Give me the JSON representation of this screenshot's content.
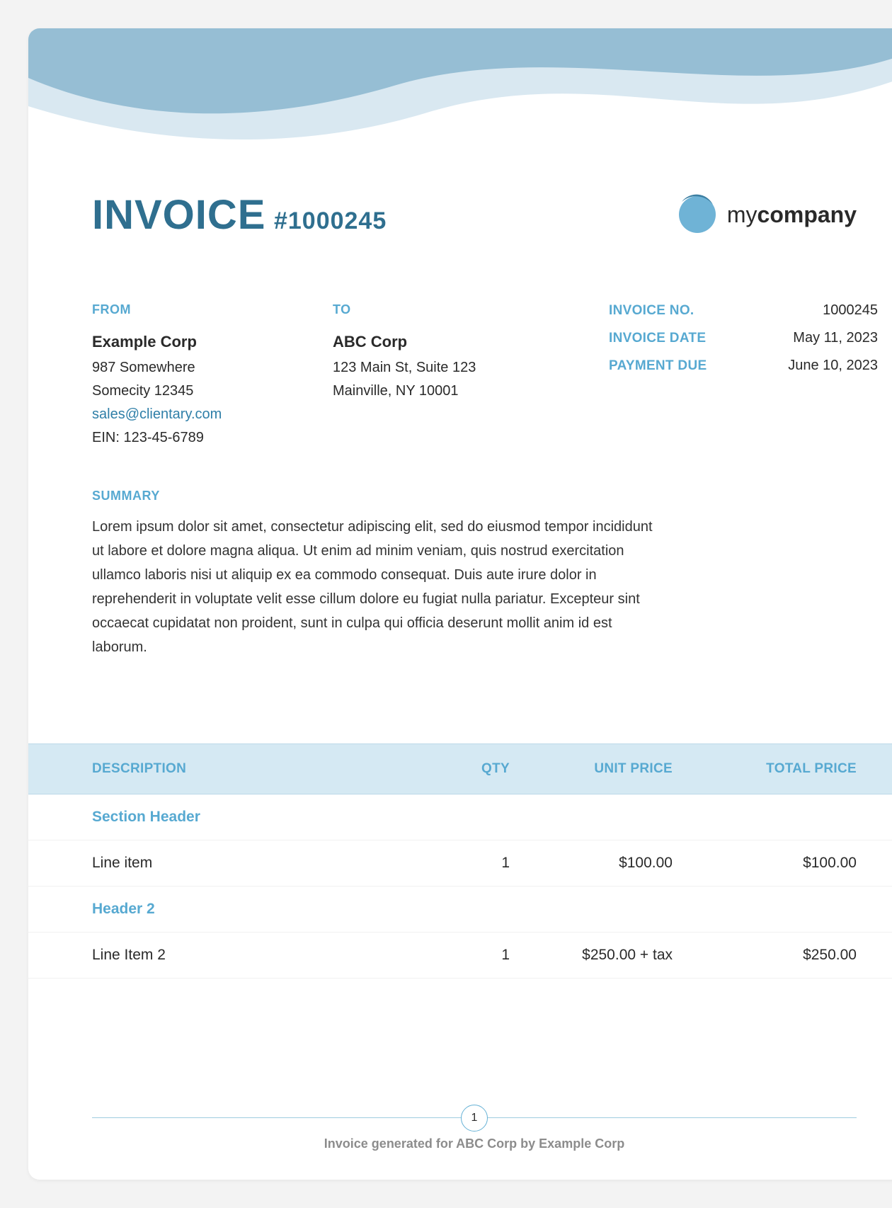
{
  "title": {
    "word": "INVOICE",
    "number_prefix": "#",
    "number": "1000245"
  },
  "logo": {
    "prefix": "my",
    "suffix": "company"
  },
  "from": {
    "label": "FROM",
    "name": "Example Corp",
    "line1": "987 Somewhere",
    "line2": "Somecity 12345",
    "email": "sales@clientary.com",
    "extra": "EIN: 123-45-6789"
  },
  "to": {
    "label": "TO",
    "name": "ABC Corp",
    "line1": "123 Main St, Suite 123",
    "line2": "Mainville, NY 10001"
  },
  "meta": {
    "invoice_no_label": "INVOICE NO.",
    "invoice_no": "1000245",
    "invoice_date_label": "INVOICE DATE",
    "invoice_date": "May 11, 2023",
    "payment_due_label": "PAYMENT DUE",
    "payment_due": "June 10, 2023"
  },
  "summary": {
    "label": "SUMMARY",
    "text": "Lorem ipsum dolor sit amet, consectetur adipiscing elit, sed do eiusmod tempor incididunt ut labore et dolore magna aliqua. Ut enim ad minim veniam, quis nostrud exercitation ullamco laboris nisi ut aliquip ex ea commodo consequat. Duis aute irure dolor in reprehenderit in voluptate velit esse cillum dolore eu fugiat nulla pariatur. Excepteur sint occaecat cupidatat non proident, sunt in culpa qui officia deserunt mollit anim id est laborum."
  },
  "columns": {
    "description": "DESCRIPTION",
    "qty": "QTY",
    "unit_price": "UNIT PRICE",
    "total_price": "TOTAL PRICE"
  },
  "rows": [
    {
      "type": "section",
      "description": "Section Header",
      "qty": "",
      "unit": "",
      "total": ""
    },
    {
      "type": "item",
      "description": "Line item",
      "qty": "1",
      "unit": "$100.00",
      "total": "$100.00"
    },
    {
      "type": "section",
      "description": "Header 2",
      "qty": "",
      "unit": "",
      "total": ""
    },
    {
      "type": "item",
      "description": "Line Item 2",
      "qty": "1",
      "unit": "$250.00 + tax",
      "total": "$250.00"
    }
  ],
  "footer": {
    "page": "1",
    "note": "Invoice generated for ABC Corp by Example Corp"
  },
  "colors": {
    "accent": "#3a99c8",
    "wave_front": "#96bed4",
    "wave_back": "#d9e8f1",
    "table_header_bg": "#d5e9f3"
  }
}
